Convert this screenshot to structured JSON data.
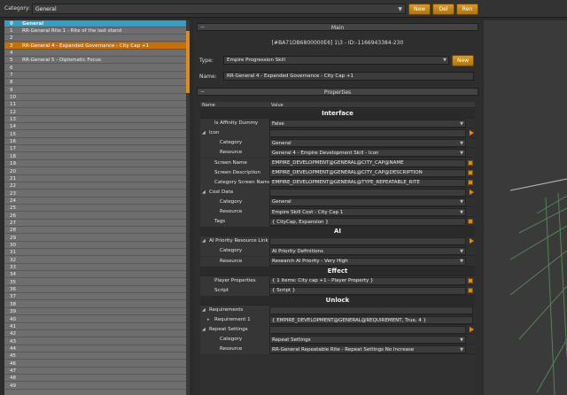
{
  "topbar": {
    "category_label": "Category:",
    "category_value": "General",
    "new_label": "New",
    "del_label": "Del",
    "ren_label": "Ren"
  },
  "left_list": {
    "header_num": "0",
    "header_label": "General",
    "items": [
      {
        "num": "1",
        "label": "RR-General Rite 1 - Rite of the last stand"
      },
      {
        "num": "2",
        "label": ""
      },
      {
        "num": "3",
        "label": "RR-General 4 - Expanded Governance - City Cap +1",
        "selected": true
      },
      {
        "num": "4",
        "label": ""
      },
      {
        "num": "5",
        "label": "RR-General 5 - Diplomatic Focus"
      },
      {
        "num": "6",
        "label": ""
      },
      {
        "num": "7",
        "label": ""
      },
      {
        "num": "8",
        "label": ""
      },
      {
        "num": "9",
        "label": ""
      },
      {
        "num": "10",
        "label": ""
      },
      {
        "num": "11",
        "label": ""
      },
      {
        "num": "12",
        "label": ""
      },
      {
        "num": "13",
        "label": ""
      },
      {
        "num": "14",
        "label": ""
      },
      {
        "num": "15",
        "label": ""
      },
      {
        "num": "16",
        "label": ""
      },
      {
        "num": "17",
        "label": ""
      },
      {
        "num": "18",
        "label": ""
      },
      {
        "num": "19",
        "label": ""
      },
      {
        "num": "20",
        "label": ""
      },
      {
        "num": "21",
        "label": ""
      },
      {
        "num": "22",
        "label": ""
      },
      {
        "num": "23",
        "label": ""
      },
      {
        "num": "24",
        "label": ""
      },
      {
        "num": "25",
        "label": ""
      },
      {
        "num": "26",
        "label": ""
      },
      {
        "num": "27",
        "label": ""
      },
      {
        "num": "28",
        "label": ""
      },
      {
        "num": "29",
        "label": ""
      },
      {
        "num": "30",
        "label": ""
      },
      {
        "num": "31",
        "label": ""
      },
      {
        "num": "32",
        "label": ""
      },
      {
        "num": "33",
        "label": ""
      },
      {
        "num": "34",
        "label": ""
      },
      {
        "num": "35",
        "label": ""
      },
      {
        "num": "36",
        "label": ""
      },
      {
        "num": "37",
        "label": ""
      },
      {
        "num": "38",
        "label": ""
      },
      {
        "num": "39",
        "label": ""
      },
      {
        "num": "40",
        "label": ""
      },
      {
        "num": "41",
        "label": ""
      },
      {
        "num": "42",
        "label": ""
      },
      {
        "num": "43",
        "label": ""
      },
      {
        "num": "44",
        "label": ""
      },
      {
        "num": "45",
        "label": ""
      },
      {
        "num": "46",
        "label": ""
      },
      {
        "num": "47",
        "label": ""
      },
      {
        "num": "48",
        "label": ""
      },
      {
        "num": "49",
        "label": ""
      }
    ]
  },
  "main": {
    "header": "Main",
    "collapse": "−",
    "id_text": "[#BA71DB6800000E6] 1\\3 - ID:-1166943384-230",
    "type_label": "Type:",
    "type_value": "Empire Progression Skill",
    "type_new": "New",
    "name_label": "Name:",
    "name_value": "RR-General 4 - Expanded Governance - City Cap +1"
  },
  "properties": {
    "header": "Properties",
    "collapse": "−",
    "col_name": "Name",
    "col_value": "Value",
    "rows": [
      {
        "kind": "cat",
        "label": "Interface"
      },
      {
        "kind": "prop",
        "indent": 1,
        "key": "Is Affinity Dummy",
        "value": "False",
        "ctrl": "arr"
      },
      {
        "kind": "prop",
        "indent": 0,
        "tri": "◢",
        "key": "Icon",
        "value": "",
        "ctrl": "orange-arrow"
      },
      {
        "kind": "prop",
        "indent": 2,
        "key": "Category",
        "value": "General",
        "ctrl": "arr"
      },
      {
        "kind": "prop",
        "indent": 2,
        "key": "Resource",
        "value": "General 4 - Empire Development Skill - Icon",
        "ctrl": "arr"
      },
      {
        "kind": "prop",
        "indent": 1,
        "key": "Screen Name",
        "value": "EMPIRE_DEVELOPMENT@GENERAL@CITY_CAP@NAME",
        "ctrl": "sq"
      },
      {
        "kind": "prop",
        "indent": 1,
        "key": "Screen Description",
        "value": "EMPIRE_DEVELOPMENT@GENERAL@CITY_CAP@DESCRIPTION",
        "ctrl": "sq"
      },
      {
        "kind": "prop",
        "indent": 1,
        "key": "Category Screen Name",
        "value": "EMPIRE_DEVELOPMENT@GENERAL@TYPE_REPEATABLE_RITE",
        "ctrl": "sq"
      },
      {
        "kind": "prop",
        "indent": 0,
        "tri": "◢",
        "key": "Cost Data",
        "value": "",
        "ctrl": "orange-arrow"
      },
      {
        "kind": "prop",
        "indent": 2,
        "key": "Category",
        "value": "General",
        "ctrl": "arr"
      },
      {
        "kind": "prop",
        "indent": 2,
        "key": "Resource",
        "value": "Empire Skill Cost - City Cap 1",
        "ctrl": "arr"
      },
      {
        "kind": "prop",
        "indent": 1,
        "key": "Tags",
        "value": "{ CityCap, Expansion }",
        "ctrl": "sq"
      },
      {
        "kind": "cat",
        "label": "AI"
      },
      {
        "kind": "prop",
        "indent": 0,
        "tri": "◢",
        "key": "AI Priority Resource Link",
        "value": "",
        "ctrl": "orange-arrow"
      },
      {
        "kind": "prop",
        "indent": 2,
        "key": "Category",
        "value": "AI Priority Definitions",
        "ctrl": "arr"
      },
      {
        "kind": "prop",
        "indent": 2,
        "key": "Resource",
        "value": "Research AI Priority - Very High",
        "ctrl": "arr"
      },
      {
        "kind": "cat",
        "label": "Effect"
      },
      {
        "kind": "prop",
        "indent": 1,
        "key": "Player Properties",
        "value": "{ 1 items: City cap +1 - Player Property }",
        "ctrl": "sq"
      },
      {
        "kind": "prop",
        "indent": 1,
        "key": "Script",
        "value": "{ Script }",
        "ctrl": "sq"
      },
      {
        "kind": "cat",
        "label": "Unlock"
      },
      {
        "kind": "prop",
        "indent": 0,
        "tri": "◢",
        "key": "Requirements",
        "value": "",
        "ctrl": "none"
      },
      {
        "kind": "prop",
        "indent": 1,
        "tri": "▸",
        "key": "Requirement 1",
        "value": "{ EMPIRE_DEVELOPMENT@GENERAL@REQUIREMENT, True, 4 }",
        "ctrl": "none"
      },
      {
        "kind": "prop",
        "indent": 0,
        "tri": "◢",
        "key": "Repeat Settings",
        "value": "",
        "ctrl": "orange-arrow"
      },
      {
        "kind": "prop",
        "indent": 2,
        "key": "Category",
        "value": "Repeat Settings",
        "ctrl": "arr"
      },
      {
        "kind": "prop",
        "indent": 2,
        "key": "Resource",
        "value": "RR-General Repeatable Rite - Repeat Settings No Increase",
        "ctrl": "arr"
      }
    ]
  },
  "colors": {
    "accent": "#d88a1c",
    "selected_row": "#c66f0a",
    "header_row": "#31a0c8"
  }
}
